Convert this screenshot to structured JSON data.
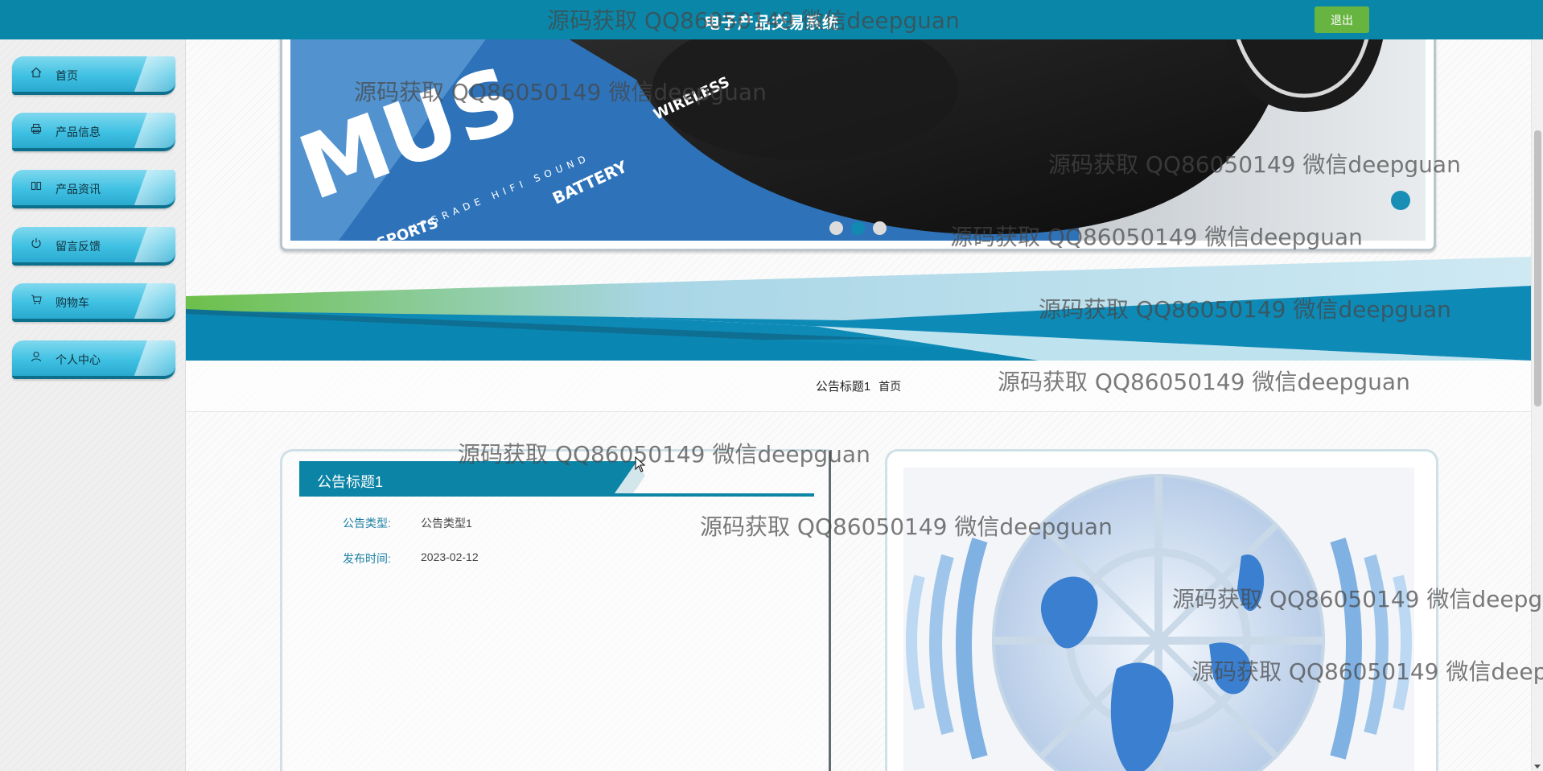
{
  "header": {
    "title": "电子产品交易系统",
    "logout_label": "退出",
    "colors": {
      "bar": "#0a87a8",
      "logout": "#67b441"
    }
  },
  "sidebar": {
    "items": [
      {
        "label": "首页",
        "icon": "home-icon"
      },
      {
        "label": "产品信息",
        "icon": "printer-icon"
      },
      {
        "label": "产品资讯",
        "icon": "book-icon"
      },
      {
        "label": "留言反馈",
        "icon": "power-icon"
      },
      {
        "label": "购物车",
        "icon": "cart-icon"
      },
      {
        "label": "个人中心",
        "icon": "user-icon"
      }
    ]
  },
  "carousel": {
    "slide_count": 3,
    "active_index": 1,
    "image_text": [
      "WIRELESS",
      "BATTERY",
      "UPGRADE HIFI SOUND",
      "SPORTS"
    ]
  },
  "breadcrumb": {
    "current": "公告标题1",
    "home": "首页"
  },
  "detail": {
    "title": "公告标题1",
    "fields": [
      {
        "label": "公告类型:",
        "value": "公告类型1"
      },
      {
        "label": "发布时间:",
        "value": "2023-02-12"
      }
    ]
  },
  "watermark": {
    "text": "源码获取 QQ86050149 微信deepguan"
  }
}
